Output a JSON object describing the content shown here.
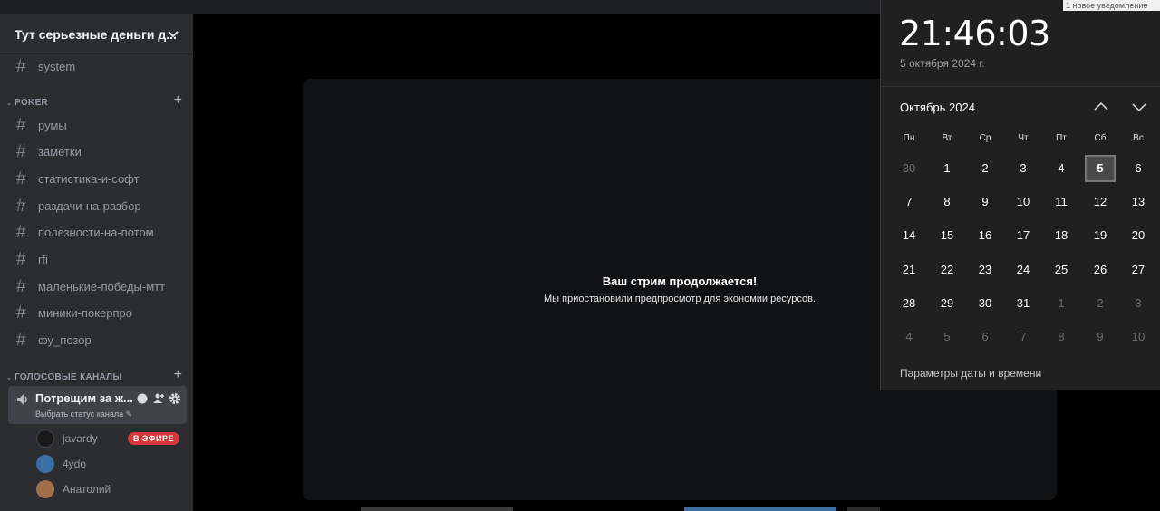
{
  "server": {
    "name": "Тут серьезные деньги д..."
  },
  "channels_top": [
    {
      "label": "system"
    }
  ],
  "categories": {
    "poker": {
      "label": "POKER"
    },
    "voice": {
      "label": "ГОЛОСОВЫЕ КАНАЛЫ"
    }
  },
  "poker_channels": [
    {
      "label": "румы"
    },
    {
      "label": "заметки"
    },
    {
      "label": "статистика-и-софт"
    },
    {
      "label": "раздачи-на-разбор"
    },
    {
      "label": "полезности-на-потом"
    },
    {
      "label": "rfi"
    },
    {
      "label": "маленькие-победы-мтт"
    },
    {
      "label": "миники-покерпро"
    },
    {
      "label": "фу_позор"
    }
  ],
  "voice_channel": {
    "name": "Потрещим за ж...",
    "status": "Выбрать статус канала"
  },
  "voice_users": [
    {
      "name": "javardy",
      "badge": "В ЭФИРЕ",
      "avatar_color": "#1a1a1a"
    },
    {
      "name": "4ydo",
      "badge": "",
      "avatar_color": "#3d6fa8"
    },
    {
      "name": "Анатолий",
      "badge": "",
      "avatar_color": "#a0704a"
    }
  ],
  "stream": {
    "title": "Ваш стрим продолжается!",
    "subtitle": "Мы приостановили предпросмотр для экономии ресурсов."
  },
  "calendar": {
    "time": "21:46:03",
    "date_long": "5 октября 2024 г.",
    "month_label": "Октябрь 2024",
    "weekdays": [
      "Пн",
      "Вт",
      "Ср",
      "Чт",
      "Пт",
      "Сб",
      "Вс"
    ],
    "days": [
      [
        "30",
        "1",
        "2",
        "3",
        "4",
        "5",
        "6"
      ],
      [
        "7",
        "8",
        "9",
        "10",
        "11",
        "12",
        "13"
      ],
      [
        "14",
        "15",
        "16",
        "17",
        "18",
        "19",
        "20"
      ],
      [
        "21",
        "22",
        "23",
        "24",
        "25",
        "26",
        "27"
      ],
      [
        "28",
        "29",
        "30",
        "31",
        "1",
        "2",
        "3"
      ],
      [
        "4",
        "5",
        "6",
        "7",
        "8",
        "9",
        "10"
      ]
    ],
    "settings_link": "Параметры даты и времени"
  },
  "notification": {
    "text": "1 новое уведомление"
  },
  "colors": {
    "live_badge": "#da373c",
    "sidebar_bg": "#2b2d31",
    "calendar_bg": "#202020"
  }
}
